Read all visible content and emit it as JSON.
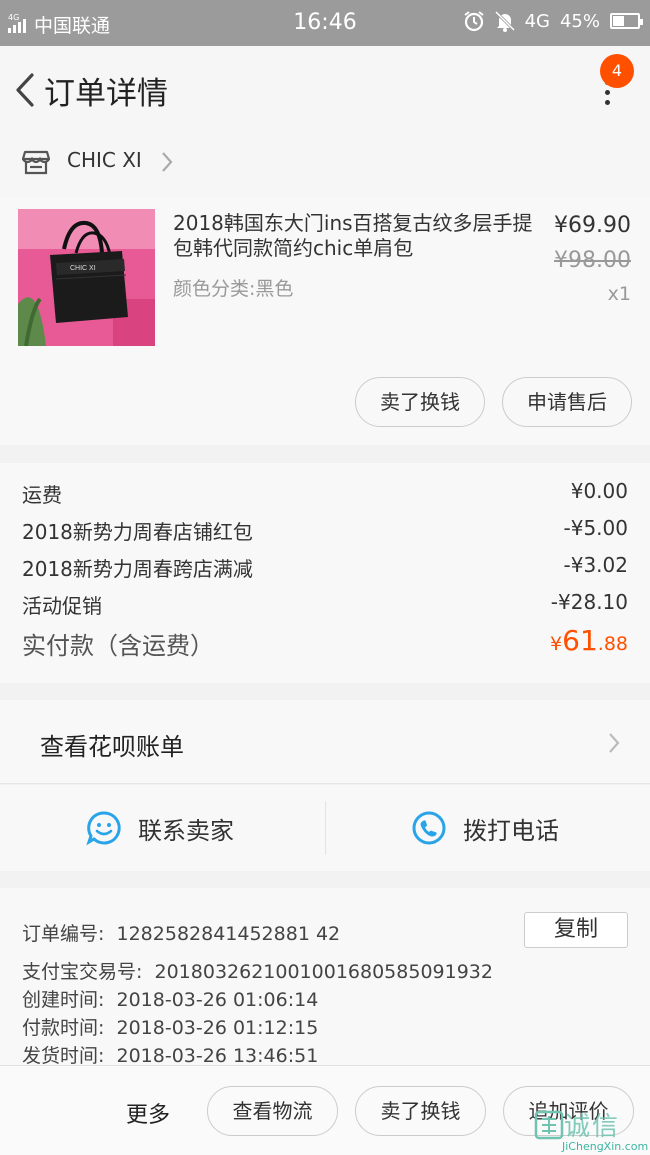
{
  "status_bar": {
    "network_tag": "4G",
    "carrier": "中国联通",
    "time": "16:46",
    "network": "4G",
    "battery": "45%",
    "battery_level": 0.45
  },
  "header": {
    "title": "订单详情",
    "badge_count": "4"
  },
  "shop": {
    "name": "CHIC XI"
  },
  "product": {
    "title": "2018韩国东大门ins百搭复古纹多层手提包韩代同款简约chic单肩包",
    "sku": "颜色分类:黑色",
    "price": "¥69.90",
    "original_price": "¥98.00",
    "quantity": "x1",
    "actions": {
      "sell": "卖了换钱",
      "after_sale": "申请售后"
    }
  },
  "fees": {
    "rows": [
      {
        "label": "运费",
        "value": "¥0.00"
      },
      {
        "label": "2018新势力周春店铺红包",
        "value": "-¥5.00"
      },
      {
        "label": "2018新势力周春跨店满减",
        "value": "-¥3.02"
      },
      {
        "label": "活动促销",
        "value": "-¥28.10"
      }
    ],
    "paid_label": "实付款（含运费）",
    "paid_currency": "¥",
    "paid_integer": "61",
    "paid_decimal": ".88"
  },
  "huabei": {
    "label": "查看花呗账单"
  },
  "contact": {
    "seller": "联系卖家",
    "call": "拨打电话"
  },
  "order_info": {
    "order_no_label": "订单编号:",
    "order_no": "1282582841452881 42",
    "copy_label": "复制",
    "alipay_label": "支付宝交易号:",
    "alipay_no": "2018032621001001680585091932",
    "created_label": "创建时间:",
    "created": "2018-03-26 01:06:14",
    "paid_label": "付款时间:",
    "paid": "2018-03-26 01:12:15",
    "shipped_label": "发货时间:",
    "shipped": "2018-03-26 13:46:51"
  },
  "bottom_bar": {
    "more": "更多",
    "logistics": "查看物流",
    "sell": "卖了换钱",
    "review": "追加评价"
  },
  "watermark": {
    "text": "JiChengXin.com",
    "cn": "诚信"
  },
  "colors": {
    "accent": "#ff5000",
    "status_bar": "#9b9b9b",
    "contact_icon": "#2aa4e8"
  }
}
